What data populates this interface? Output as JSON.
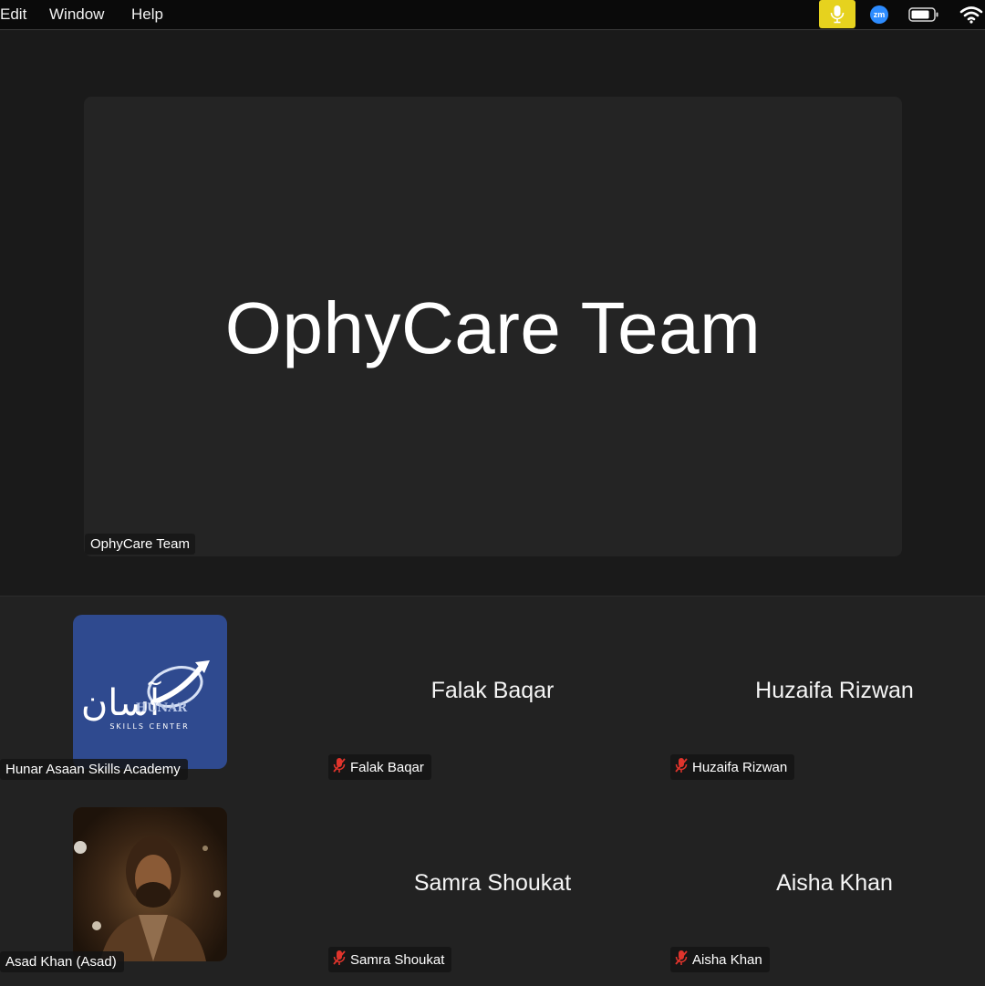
{
  "menubar": {
    "items": [
      "Edit",
      "Window",
      "Help"
    ],
    "tray_zoom_label": "zm"
  },
  "stage": {
    "active_speaker": "OphyCare Team",
    "active_speaker_label": "OphyCare Team"
  },
  "gallery": {
    "participants": [
      {
        "name": "Hunar Asaan Skills Academy",
        "display": "",
        "muted": false,
        "media": "logo",
        "logo": {
          "arabic": "آسان",
          "word": "HUNAR",
          "tagline": "SKILLS CENTER"
        }
      },
      {
        "name": "Falak Baqar",
        "display": "Falak Baqar",
        "muted": true
      },
      {
        "name": "Huzaifa Rizwan",
        "display": "Huzaifa Rizwan",
        "muted": true
      },
      {
        "name": "Asad Khan (Asad)",
        "display": "",
        "muted": false,
        "media": "photo"
      },
      {
        "name": "Samra Shoukat",
        "display": "Samra Shoukat",
        "muted": true
      },
      {
        "name": "Aisha Khan",
        "display": "Aisha Khan",
        "muted": true
      }
    ]
  },
  "colors": {
    "mic_highlight": "#e6d21e",
    "zoom_blue": "#2d8cff",
    "muted_red": "#e0342c",
    "logo_bg": "#2f4a8f"
  }
}
